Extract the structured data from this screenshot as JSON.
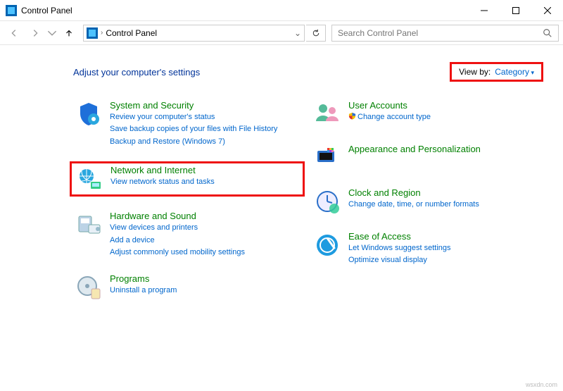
{
  "window": {
    "title": "Control Panel"
  },
  "breadcrumb": {
    "location": "Control Panel"
  },
  "search": {
    "placeholder": "Search Control Panel"
  },
  "page": {
    "heading": "Adjust your computer's settings",
    "viewby_label": "View by:",
    "viewby_value": "Category"
  },
  "left": [
    {
      "title": "System and Security",
      "links": [
        "Review your computer's status",
        "Save backup copies of your files with File History",
        "Backup and Restore (Windows 7)"
      ]
    },
    {
      "title": "Network and Internet",
      "links": [
        "View network status and tasks"
      ],
      "highlighted": true
    },
    {
      "title": "Hardware and Sound",
      "links": [
        "View devices and printers",
        "Add a device",
        "Adjust commonly used mobility settings"
      ]
    },
    {
      "title": "Programs",
      "links": [
        "Uninstall a program"
      ]
    }
  ],
  "right": [
    {
      "title": "User Accounts",
      "links": [
        "Change account type"
      ],
      "shield": true
    },
    {
      "title": "Appearance and Personalization",
      "links": []
    },
    {
      "title": "Clock and Region",
      "links": [
        "Change date, time, or number formats"
      ]
    },
    {
      "title": "Ease of Access",
      "links": [
        "Let Windows suggest settings",
        "Optimize visual display"
      ]
    }
  ],
  "watermark": "wsxdn.com"
}
